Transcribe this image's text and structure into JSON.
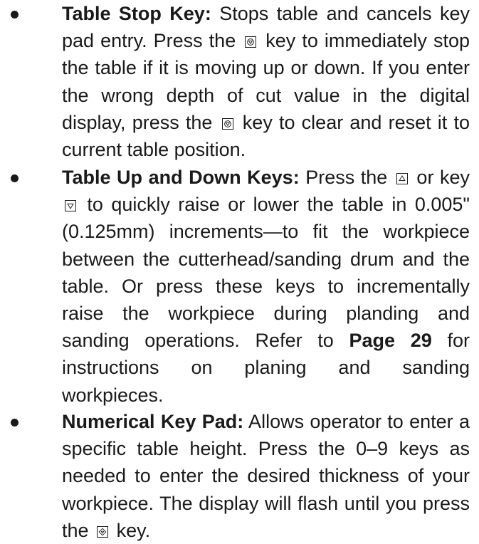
{
  "items": [
    {
      "title": "Table Stop Key:",
      "p1": " Stops table and cancels key pad entry. Press the",
      "p2": "key to immediately stop the table if it is moving up or down. If you enter the wrong depth of cut value in the digital display, press the",
      "p3": "key to clear and reset it to current table position."
    },
    {
      "title": "Table Up and Down Keys:",
      "p1": " Press the",
      "p2": "or key",
      "p3": "to quickly raise or lower the table in 0.005\" (0.125mm) increments—to fit the workpiece between the cutterhead/sanding drum and the table. Or press these keys to incrementally raise the workpiece during planding and sanding operations. Refer to",
      "page_ref": "Page 29",
      "p4": " for instructions on planing and sanding workpieces."
    },
    {
      "title": "Numerical Key Pad:",
      "p1": " Allows operator to enter a specific table height. Press the 0–9 keys as needed to enter the desired thickness of your workpiece. The display will flash until you press the",
      "p2": "key."
    }
  ],
  "icons": {
    "stop": "stop-key-icon",
    "up": "up-arrow-key-icon",
    "down": "down-arrow-key-icon",
    "enter": "enter-key-icon"
  }
}
